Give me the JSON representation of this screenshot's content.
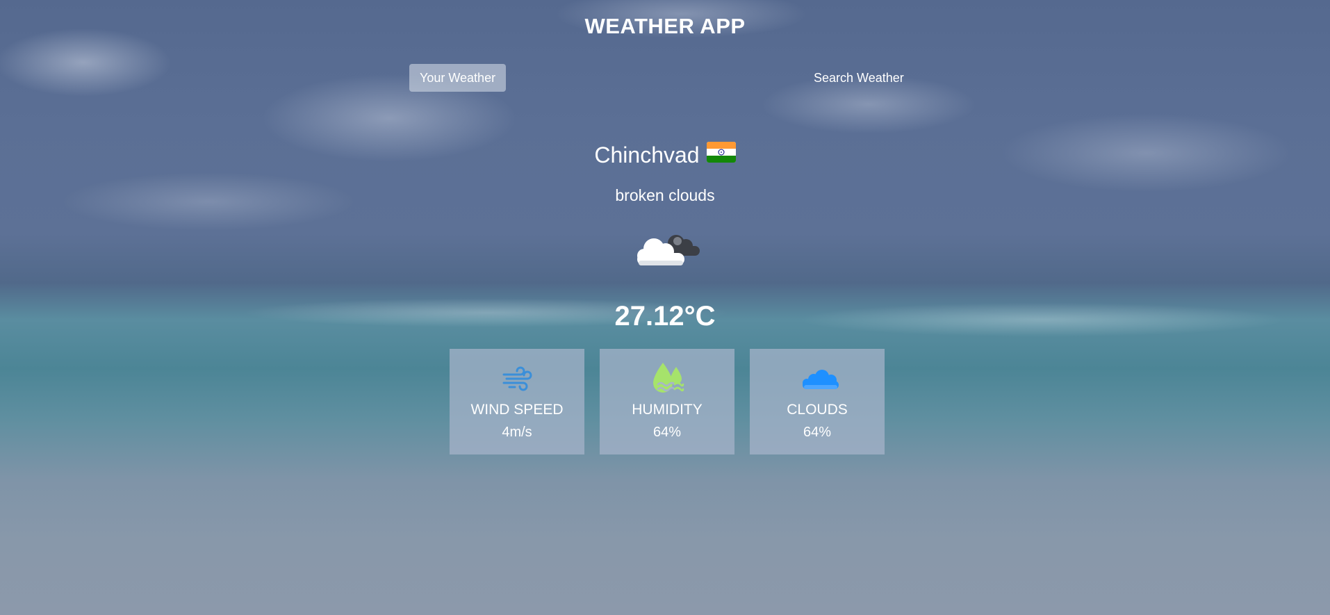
{
  "app": {
    "title": "WEATHER APP"
  },
  "tabs": [
    {
      "label": "Your Weather",
      "active": true
    },
    {
      "label": "Search Weather",
      "active": false
    }
  ],
  "location": {
    "city": "Chinchvad",
    "country_flag_icon": "india-flag-icon"
  },
  "current": {
    "description": "broken clouds",
    "icon": "broken-clouds-icon",
    "temperature": "27.12°C"
  },
  "stats": [
    {
      "label": "WIND SPEED",
      "value": "4m/s",
      "icon": "wind-icon",
      "color": "#3b8fd9"
    },
    {
      "label": "HUMIDITY",
      "value": "64%",
      "icon": "humidity-icon",
      "color": "#a6e36b"
    },
    {
      "label": "CLOUDS",
      "value": "64%",
      "icon": "cloud-icon",
      "color": "#1e90ff"
    }
  ]
}
